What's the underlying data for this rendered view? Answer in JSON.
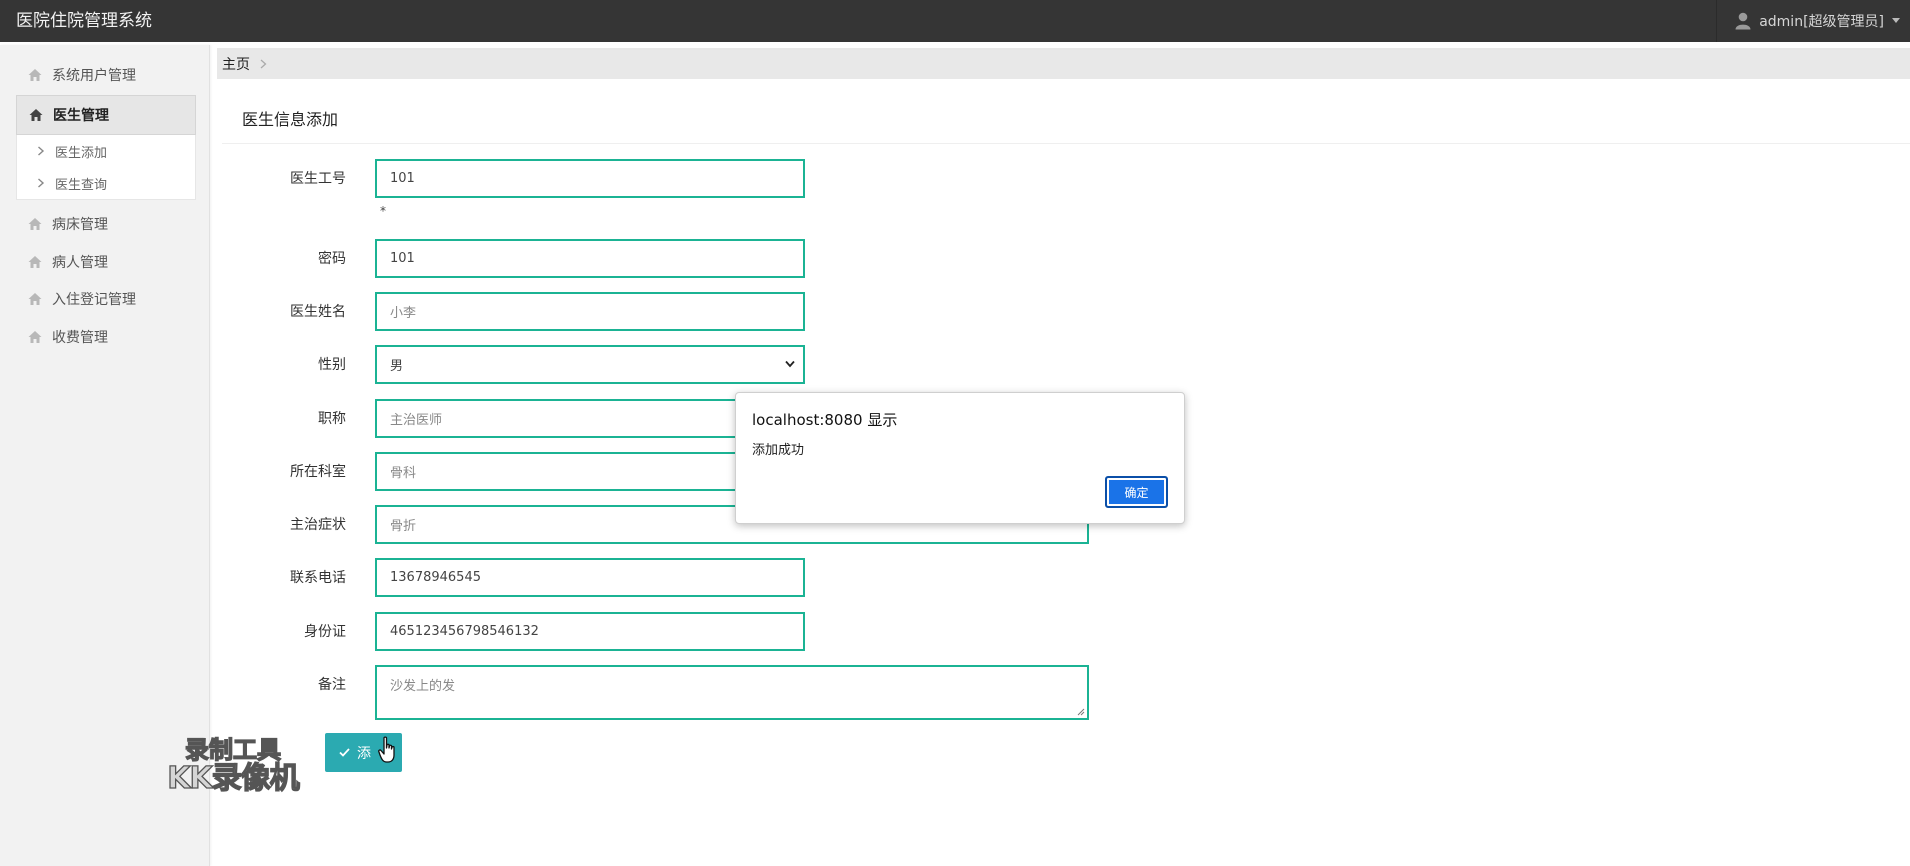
{
  "app": {
    "title": "医院住院管理系统",
    "user_label": "admin[超级管理员]"
  },
  "sidebar": {
    "items": [
      {
        "label": "系统用户管理",
        "icon": "home-icon"
      },
      {
        "label": "医生管理",
        "icon": "home-icon",
        "active": true
      },
      {
        "label": "病床管理",
        "icon": "home-icon"
      },
      {
        "label": "病人管理",
        "icon": "home-icon"
      },
      {
        "label": "入住登记管理",
        "icon": "home-icon"
      },
      {
        "label": "收费管理",
        "icon": "home-icon"
      }
    ],
    "submenu": [
      {
        "label": "医生添加",
        "icon": "chevron-right-icon"
      },
      {
        "label": "医生查询",
        "icon": "chevron-right-icon"
      }
    ]
  },
  "breadcrumb": {
    "home": "主页"
  },
  "form": {
    "title": "医生信息添加",
    "required_mark": "*",
    "fields": [
      {
        "label": "医生工号",
        "value": "101"
      },
      {
        "label": "密码",
        "value": "101"
      },
      {
        "label": "医生姓名",
        "value": "",
        "placeholder": "小李"
      },
      {
        "label": "性别",
        "value": "男"
      },
      {
        "label": "职称",
        "value": "",
        "placeholder": "主治医师"
      },
      {
        "label": "所在科室",
        "value": "",
        "placeholder": "骨科"
      },
      {
        "label": "主治症状",
        "value": "",
        "placeholder": "骨折"
      },
      {
        "label": "联系电话",
        "value": "13678946545"
      },
      {
        "label": "身份证",
        "value": "465123456798546132"
      },
      {
        "label": "备注",
        "value": "",
        "placeholder": "沙发上的发"
      }
    ],
    "submit_label": "添"
  },
  "dialog": {
    "title": "localhost:8080 显示",
    "message": "添加成功",
    "ok_label": "确定"
  },
  "watermark": {
    "line1": "录制工具",
    "line2": "KK录像机"
  },
  "colors": {
    "navbar": "#353535",
    "field_border": "#1bb394",
    "submit_button": "#2baab1",
    "dialog_button": "#1a73e8"
  }
}
